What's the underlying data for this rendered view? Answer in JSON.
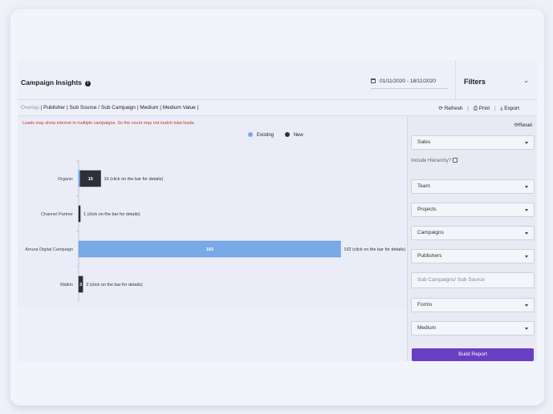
{
  "header": {
    "title": "Campaign Insights",
    "date_range": "01/11/2020 - 18/11/2020"
  },
  "filters": {
    "title": "Filters",
    "reset_label": "Reset",
    "include_hierarchy_label": "Include Hierarchy?",
    "fields": [
      {
        "label": "Sales",
        "type": "select"
      },
      {
        "label": "Team",
        "type": "select"
      },
      {
        "label": "Projects",
        "type": "select"
      },
      {
        "label": "Campaigns",
        "type": "select"
      },
      {
        "label": "Publishers",
        "type": "select"
      },
      {
        "label": "Sub Campaigns/ Sub Source",
        "type": "text"
      },
      {
        "label": "Forms",
        "type": "select"
      },
      {
        "label": "Medium",
        "type": "select"
      }
    ],
    "build_button": "Build Report"
  },
  "toolbar": {
    "breadcrumb": [
      "Overlap",
      "Publisher",
      "Sub Source / Sub Campaign",
      "Medium",
      "Medium Value"
    ],
    "refresh": "Refresh",
    "print": "Print",
    "export": "Export"
  },
  "note": "Leads may show interest in multiple campaigns. So the count may not match total leads.",
  "colors": {
    "existing": "#7aa9e8",
    "new": "#2e2f3a",
    "accent": "#6a3ec2",
    "warning": "#c0362c"
  },
  "chart_data": {
    "type": "bar",
    "orientation": "horizontal",
    "stacked": true,
    "categories": [
      "Organic",
      "Channel Partner",
      "Amura Digital Campaign",
      "Walkin"
    ],
    "series": [
      {
        "name": "Existing",
        "values": [
          1,
          0,
          192,
          0
        ]
      },
      {
        "name": "New",
        "values": [
          15,
          1,
          0,
          3
        ]
      }
    ],
    "data_labels": [
      "16 (click on the bar for details)",
      "1 (click on the bar for details)",
      "192 (click on the bar for details)",
      "3 (click on the bar for details)"
    ],
    "segment_labels": [
      [
        "",
        "15"
      ],
      [
        "",
        ""
      ],
      [
        "192",
        ""
      ],
      [
        "",
        "3"
      ]
    ],
    "xlim": [
      0,
      200
    ],
    "legend": "top-center"
  }
}
